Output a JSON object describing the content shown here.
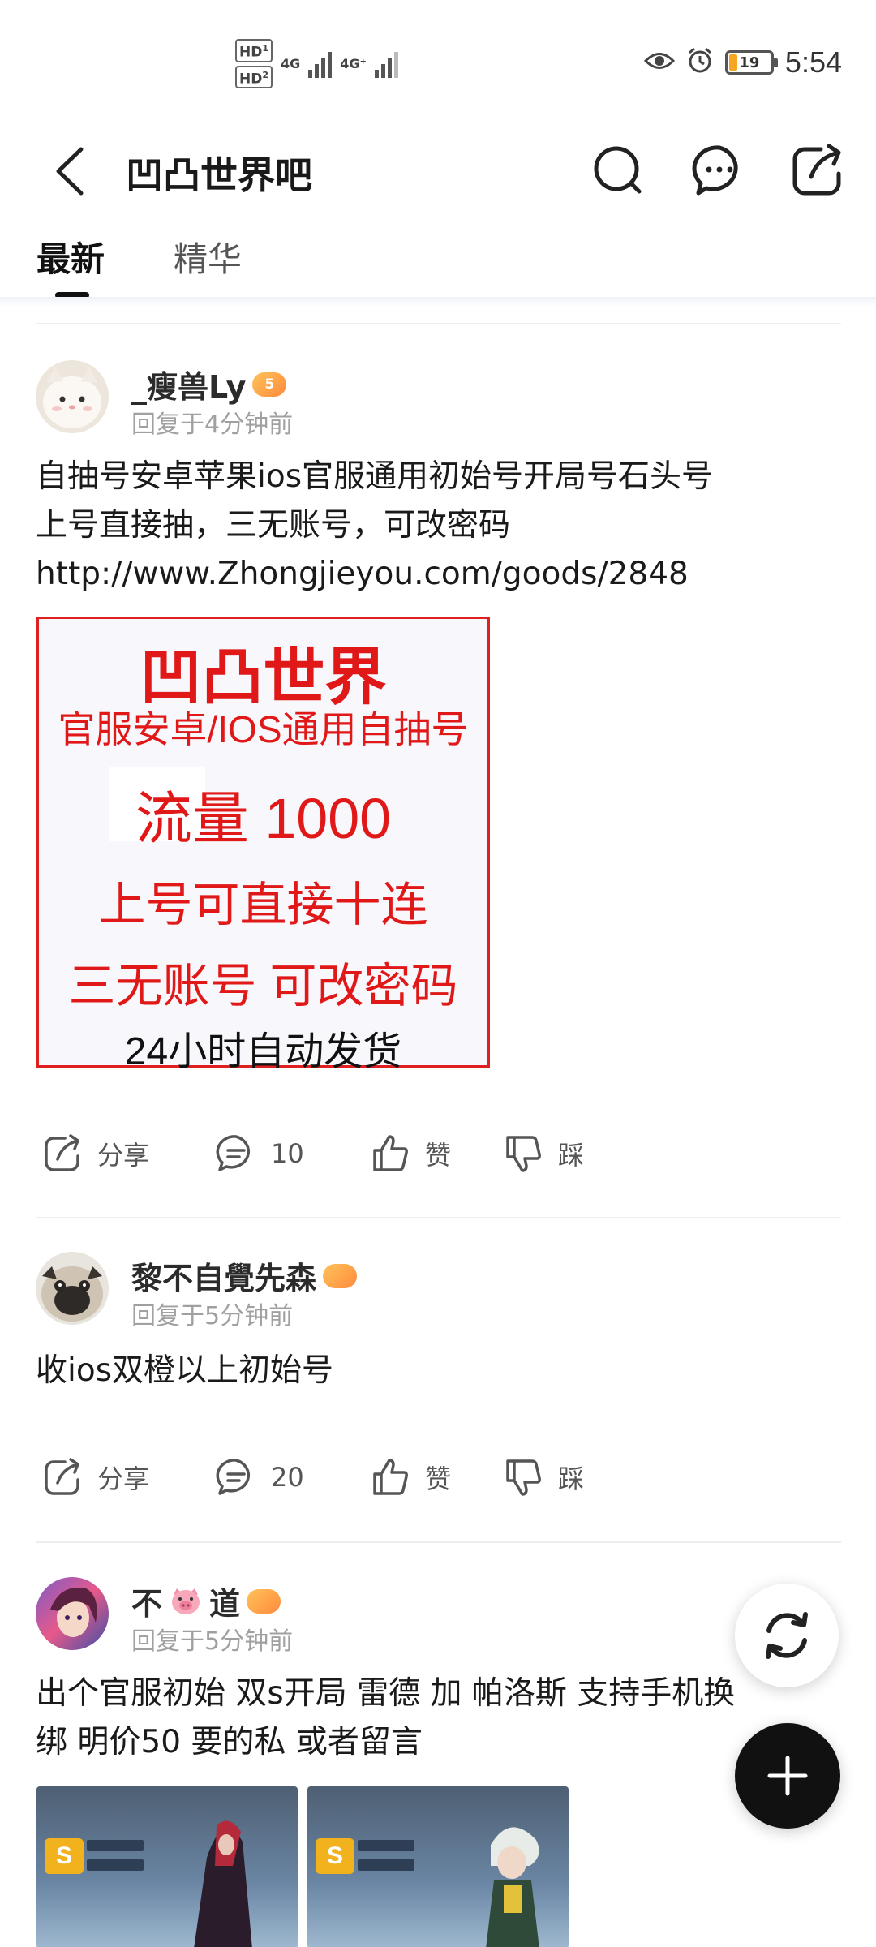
{
  "status_bar": {
    "sim1": "HD",
    "sim1_index": "1",
    "sim2": "HD",
    "sim2_index": "2",
    "net1": "4G",
    "net2": "4G⁺",
    "battery_level": "19",
    "battery_fraction": 0.19,
    "time": "5:54",
    "icons": [
      "eye-icon",
      "alarm-icon",
      "battery-icon"
    ]
  },
  "header": {
    "title": "凹凸世界吧",
    "icons": [
      "back-arrow-icon",
      "search-icon",
      "chat-bubble-icon",
      "share-icon"
    ]
  },
  "tabs": [
    {
      "label": "最新",
      "active": true
    },
    {
      "label": "精华",
      "active": false
    }
  ],
  "posts": [
    {
      "username": "_瘦兽Ly",
      "level": "5",
      "time": "回复于4分钟前",
      "text_lines": [
        "自抽号安卓苹果ios官服通用初始号开局号石头号",
        "上号直接抽，三无账号，可改密码",
        "http://www.Zhongjieyou.com/goods/2848"
      ],
      "image_text": {
        "line1": "凹凸世界",
        "line2": "官服安卓/IOS通用自抽号",
        "line3": "流量 1000",
        "line4": "上号可直接十连",
        "line5": "三无账号 可改密码",
        "line6": "24小时自动发货"
      },
      "actions": {
        "share": "分享",
        "comments": "10",
        "like": "赞",
        "dislike": "踩"
      }
    },
    {
      "username": "黎不自覺先森",
      "time": "回复于5分钟前",
      "text_lines": [
        "收ios双橙以上初始号"
      ],
      "actions": {
        "share": "分享",
        "comments": "20",
        "like": "赞",
        "dislike": "踩"
      }
    },
    {
      "username_part1": "不",
      "username_part2": "道",
      "time": "回复于5分钟前",
      "text_lines": [
        "出个官服初始 双s开局 雷德 加 帕洛斯 支持手机换",
        "绑 明价50 要的私 或者留言"
      ],
      "thumbnails": [
        {
          "badge": "S"
        },
        {
          "badge": "S"
        }
      ]
    }
  ],
  "colors": {
    "promo_red": "#e01818",
    "badge_orange": "#ff8a3d",
    "fab_dark": "#111111"
  }
}
